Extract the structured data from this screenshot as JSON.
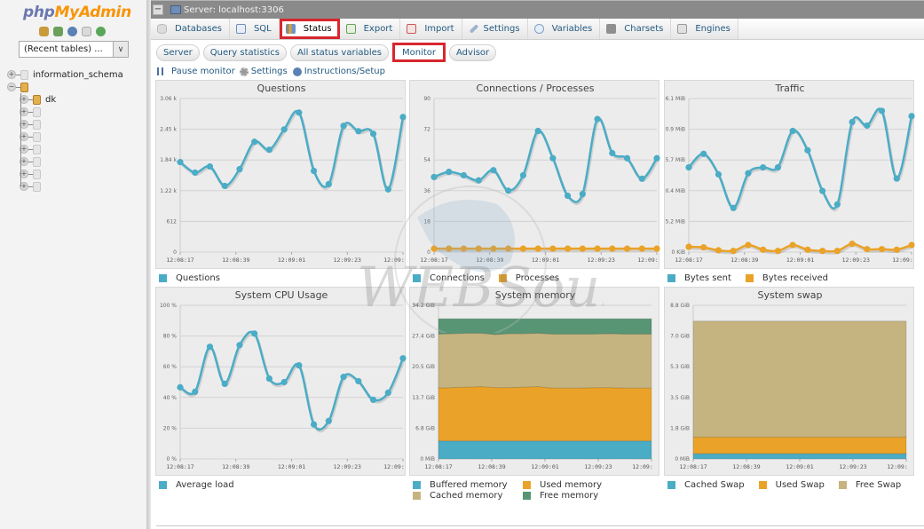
{
  "sidebar": {
    "logo_php": "php",
    "logo_myadmin": "MyAdmin",
    "recent_tables": "(Recent tables) ...",
    "databases": [
      {
        "name": "information_schema",
        "expanded": false
      },
      {
        "name": "",
        "expanded": true
      },
      {
        "name": "dk",
        "expanded": false
      },
      {
        "name": "",
        "expanded": false
      },
      {
        "name": "",
        "expanded": false
      },
      {
        "name": "",
        "expanded": false
      },
      {
        "name": "",
        "expanded": false
      },
      {
        "name": "",
        "expanded": false
      },
      {
        "name": "",
        "expanded": false
      },
      {
        "name": "",
        "expanded": false
      }
    ]
  },
  "topbar": {
    "server": "Server: localhost:3306"
  },
  "tabs": [
    {
      "label": "Databases",
      "active": false
    },
    {
      "label": "SQL",
      "active": false
    },
    {
      "label": "Status",
      "active": true
    },
    {
      "label": "Export",
      "active": false
    },
    {
      "label": "Import",
      "active": false
    },
    {
      "label": "Settings",
      "active": false
    },
    {
      "label": "Variables",
      "active": false
    },
    {
      "label": "Charsets",
      "active": false
    },
    {
      "label": "Engines",
      "active": false
    }
  ],
  "subtabs": [
    {
      "label": "Server",
      "active": false
    },
    {
      "label": "Query statistics",
      "active": false
    },
    {
      "label": "All status variables",
      "active": false
    },
    {
      "label": "Monitor",
      "active": true
    },
    {
      "label": "Advisor",
      "active": false
    }
  ],
  "monitor_bar": {
    "pause": "Pause monitor",
    "settings": "Settings",
    "instructions": "Instructions/Setup"
  },
  "watermark": "WEBSouls",
  "colors": {
    "series_blue": "#4bacc6",
    "series_orange": "#eaa228",
    "series_tan": "#c5b47f",
    "series_green": "#579575",
    "highlight": "#d8262e"
  },
  "chart_data": [
    {
      "id": "questions",
      "type": "line",
      "title": "Questions",
      "x": [
        "12:08:17",
        "",
        "",
        "",
        "12:08:39",
        "",
        "",
        "",
        "12:09:01",
        "",
        "",
        "",
        "12:09:23",
        "",
        "",
        ""
      ],
      "xticks": [
        "12:08:17",
        "12:08:39",
        "12:09:01",
        "12:09:23",
        "12:09:"
      ],
      "yticks": [
        "0",
        "612",
        "1.22 k",
        "1.84 k",
        "2.45 k",
        "3.06 k"
      ],
      "ylim": [
        0,
        3060
      ],
      "series": [
        {
          "name": "Questions",
          "color": "#4bacc6",
          "values": [
            1794,
            1583,
            1706,
            1319,
            1653,
            2198,
            2040,
            2444,
            2779,
            1618,
            1354,
            2515,
            2409,
            2357,
            1249,
            2691
          ]
        }
      ]
    },
    {
      "id": "connections",
      "type": "line",
      "title": "Connections / Processes",
      "xticks": [
        "12:08:17",
        "12:08:39",
        "12:09:01",
        "12:09:23",
        "12:09:"
      ],
      "yticks": [
        "0",
        "18",
        "36",
        "54",
        "72",
        "90"
      ],
      "ylim": [
        0,
        90
      ],
      "series": [
        {
          "name": "Connections",
          "color": "#4bacc6",
          "values": [
            44,
            47,
            45,
            42,
            48,
            36,
            45,
            71,
            55,
            33,
            34,
            78,
            58,
            55,
            43,
            55
          ]
        },
        {
          "name": "Processes",
          "color": "#eaa228",
          "values": [
            2,
            2,
            2,
            2,
            2,
            2,
            2,
            2,
            2,
            2,
            2,
            2,
            2,
            2,
            2,
            2
          ]
        }
      ]
    },
    {
      "id": "traffic",
      "type": "line",
      "title": "Traffic",
      "xticks": [
        "12:08:17",
        "12:08:39",
        "12:09:01",
        "12:09:23",
        "12:09:"
      ],
      "yticks": [
        "0 KiB",
        "5.2 MiB",
        "10.4 MiB",
        "15.7 MiB",
        "20.9 MiB",
        "26.1 MiB"
      ],
      "ylim": [
        0,
        26.1
      ],
      "yunit": "MiB",
      "series": [
        {
          "name": "Bytes sent",
          "color": "#4bacc6",
          "values": [
            14.4,
            16.7,
            13.2,
            7.5,
            13.4,
            14.4,
            14.4,
            20.6,
            17.3,
            10.4,
            8.1,
            22.1,
            21.5,
            24.0,
            12.5,
            23.1
          ]
        },
        {
          "name": "Bytes received",
          "color": "#eaa228",
          "values": [
            0.9,
            0.8,
            0.3,
            0.2,
            1.2,
            0.4,
            0.2,
            1.2,
            0.4,
            0.2,
            0.2,
            1.4,
            0.5,
            0.5,
            0.4,
            1.2
          ]
        }
      ]
    },
    {
      "id": "cpu",
      "type": "line",
      "title": "System CPU Usage",
      "xticks": [
        "12:08:17",
        "12:08:39",
        "12:09:01",
        "12:09:23",
        "12:09:"
      ],
      "yticks": [
        "0 %",
        "20 %",
        "40 %",
        "60 %",
        "80 %",
        "100 %"
      ],
      "ylim": [
        0,
        100
      ],
      "yunit": "%",
      "series": [
        {
          "name": "Average load",
          "color": "#4bacc6",
          "values": [
            46.6,
            43.7,
            73,
            48.9,
            74.1,
            81.6,
            52.3,
            50,
            60.9,
            22.4,
            24.7,
            53.4,
            50.6,
            38.5,
            43.1,
            65.5
          ]
        }
      ]
    },
    {
      "id": "memory",
      "type": "area",
      "stacked": true,
      "title": "System memory",
      "xticks": [
        "12:08:17",
        "12:08:39",
        "12:09:01",
        "12:09:23",
        "12:09:"
      ],
      "yticks": [
        "0 MiB",
        "6.8 GiB",
        "13.7 GiB",
        "20.5 GiB",
        "27.4 GiB",
        "34.2 GiB"
      ],
      "ylim": [
        0,
        34.2
      ],
      "yunit": "GiB",
      "series": [
        {
          "name": "Buffered memory",
          "color": "#4bacc6",
          "values": [
            4.0,
            4.0,
            4.0,
            4.0,
            4.0,
            4.0,
            4.0,
            4.0,
            4.0,
            4.0,
            4.0,
            4.0,
            4.0,
            4.0,
            4.0,
            4.0
          ]
        },
        {
          "name": "Used memory",
          "color": "#eaa228",
          "values": [
            11.8,
            11.9,
            12.0,
            12.1,
            11.9,
            11.9,
            12.0,
            12.1,
            11.8,
            11.8,
            11.8,
            11.9,
            11.9,
            11.8,
            11.8,
            11.8
          ]
        },
        {
          "name": "Cached memory",
          "color": "#c5b47f",
          "values": [
            12.0,
            12.0,
            12.0,
            11.9,
            11.8,
            12.0,
            11.9,
            11.9,
            12.0,
            12.0,
            12.0,
            11.9,
            12.0,
            12.0,
            12.0,
            12.0
          ]
        },
        {
          "name": "Free memory",
          "color": "#579575",
          "values": [
            3.4,
            3.3,
            3.2,
            3.2,
            3.5,
            3.3,
            3.3,
            3.2,
            3.4,
            3.4,
            3.4,
            3.4,
            3.3,
            3.4,
            3.4,
            3.4
          ]
        }
      ],
      "legend_order": [
        "Buffered memory",
        "Used memory",
        "Cached memory",
        "Free memory"
      ]
    },
    {
      "id": "swap",
      "type": "area",
      "stacked": true,
      "title": "System swap",
      "xticks": [
        "12:08:17",
        "12:08:39",
        "12:09:01",
        "12:09:23",
        "12:09:"
      ],
      "yticks": [
        "0 MiB",
        "1.8 GiB",
        "3.5 GiB",
        "5.3 GiB",
        "7.0 GiB",
        "8.8 GiB"
      ],
      "ylim": [
        0,
        8.8
      ],
      "yunit": "GiB",
      "series": [
        {
          "name": "Cached Swap",
          "color": "#4bacc6",
          "values": [
            0.3,
            0.3,
            0.3,
            0.3,
            0.3,
            0.3,
            0.3,
            0.3,
            0.3,
            0.3,
            0.3,
            0.3,
            0.3,
            0.3,
            0.3,
            0.3
          ]
        },
        {
          "name": "Used Swap",
          "color": "#eaa228",
          "values": [
            0.95,
            0.95,
            0.95,
            0.95,
            0.95,
            0.95,
            0.95,
            0.95,
            0.95,
            0.95,
            0.95,
            0.95,
            0.95,
            0.95,
            0.95,
            0.95
          ]
        },
        {
          "name": "Free Swap",
          "color": "#c5b47f",
          "values": [
            6.65,
            6.65,
            6.65,
            6.65,
            6.65,
            6.65,
            6.65,
            6.65,
            6.65,
            6.65,
            6.65,
            6.65,
            6.65,
            6.65,
            6.65,
            6.65
          ]
        }
      ]
    }
  ]
}
